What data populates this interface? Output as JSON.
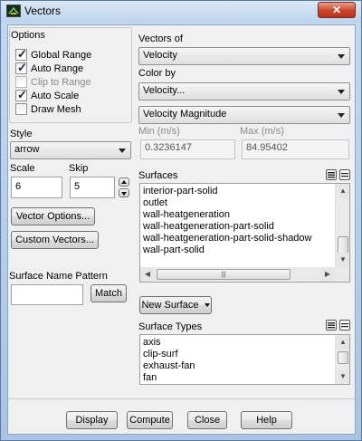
{
  "window": {
    "title": "Vectors",
    "close_glyph": "✕"
  },
  "options": {
    "label": "Options",
    "items": [
      {
        "label": "Global Range",
        "checked": true,
        "enabled": true
      },
      {
        "label": "Auto Range",
        "checked": true,
        "enabled": true
      },
      {
        "label": "Clip to Range",
        "checked": false,
        "enabled": false
      },
      {
        "label": "Auto Scale",
        "checked": true,
        "enabled": true
      },
      {
        "label": "Draw Mesh",
        "checked": false,
        "enabled": true
      }
    ]
  },
  "style": {
    "label": "Style",
    "value": "arrow"
  },
  "scale": {
    "label": "Scale",
    "value": "6"
  },
  "skip": {
    "label": "Skip",
    "value": "5"
  },
  "buttons": {
    "vector_options": "Vector Options...",
    "custom_vectors": "Custom Vectors...",
    "match": "Match",
    "new_surface": "New Surface",
    "display": "Display",
    "compute": "Compute",
    "close": "Close",
    "help": "Help"
  },
  "surface_name_pattern": {
    "label": "Surface Name Pattern",
    "value": ""
  },
  "vectors_of": {
    "label": "Vectors of",
    "value": "Velocity"
  },
  "color_by": {
    "label": "Color by",
    "category": "Velocity...",
    "quantity": "Velocity Magnitude"
  },
  "range": {
    "min_label": "Min (m/s)",
    "min_value": "0.3236147",
    "max_label": "Max (m/s)",
    "max_value": "84.95402"
  },
  "surfaces": {
    "label": "Surfaces",
    "items": [
      "interior-part-solid",
      "outlet",
      "wall-heatgeneration",
      "wall-heatgeneration-part-solid",
      "wall-heatgeneration-part-solid-shadow",
      "wall-part-solid"
    ]
  },
  "surface_types": {
    "label": "Surface Types",
    "items": [
      "axis",
      "clip-surf",
      "exhaust-fan",
      "fan"
    ]
  },
  "colors": {
    "close_button": "#c7442a",
    "titlebar": "#bcd3ec"
  }
}
